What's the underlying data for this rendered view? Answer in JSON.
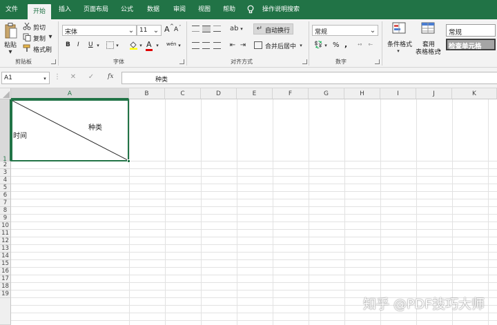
{
  "tabs": [
    "文件",
    "开始",
    "插入",
    "页面布局",
    "公式",
    "数据",
    "审阅",
    "视图",
    "帮助",
    "操作说明搜索"
  ],
  "icons": {
    "lightbulb": "lightbulb-icon",
    "paste": "clipboard-icon",
    "cut": "scissors-icon",
    "copy": "copy-icon",
    "format_painter": "paintbrush-icon",
    "cancel": "x-icon",
    "confirm": "check-icon"
  },
  "clipboard": {
    "paste_label": "粘贴",
    "cut_label": "剪切",
    "copy_label": "复制",
    "format_painter_label": "格式刷",
    "group_label": "剪贴板"
  },
  "font": {
    "name": "宋体",
    "size": "11",
    "grow": "A",
    "shrink": "A",
    "bold": "B",
    "italic": "I",
    "underline": "U",
    "font_color": "A",
    "phonetic": "wén",
    "group_label": "字体"
  },
  "alignment": {
    "wrap_text": "自动换行",
    "merge_center": "合并后居中",
    "group_label": "对齐方式"
  },
  "number": {
    "format": "常规",
    "percent": "%",
    "comma": ",",
    "group_label": "数字"
  },
  "styles": {
    "conditional_formatting": "条件格式",
    "format_as_table_line1": "套用",
    "format_as_table_line2": "表格格式",
    "style_normal": "常规",
    "style_check_cell": "检查单元格"
  },
  "formula_bar": {
    "name_box": "A1",
    "fx": "fx",
    "content": "种类"
  },
  "sheet": {
    "columns": [
      "A",
      "B",
      "C",
      "D",
      "E",
      "F",
      "G",
      "H",
      "I",
      "J",
      "K"
    ],
    "rows": [
      "1",
      "2",
      "3",
      "4",
      "5",
      "6",
      "7",
      "8",
      "9",
      "10",
      "11",
      "12",
      "13",
      "14",
      "15",
      "16",
      "17",
      "18",
      "19"
    ],
    "cell_a1_top_right": "种类",
    "cell_a1_bottom_left": "时间"
  },
  "colors": {
    "accent": "#217346",
    "selection": "#217346"
  },
  "watermark": "知乎 @PDF技巧大师"
}
